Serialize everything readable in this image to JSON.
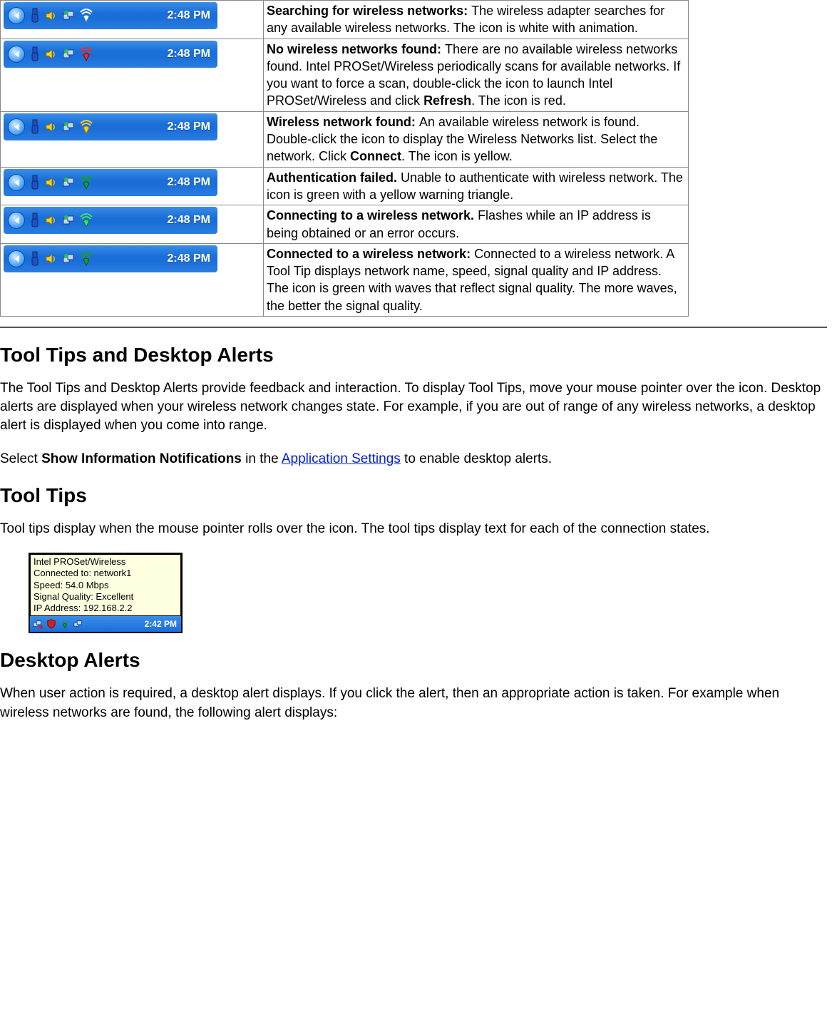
{
  "tray_time": "2:48 PM",
  "rows": [
    {
      "wifi_fill": "#ffffff",
      "wifi_stroke": "#2a7de0",
      "title": "Searching for wireless networks: ",
      "text_a": "The wireless adapter searches for any available wireless networks. The icon is white with animation.",
      "extra_bold": "",
      "text_b": ""
    },
    {
      "wifi_fill": "#e03030",
      "wifi_stroke": "#8a0000",
      "title": "No wireless networks found: ",
      "text_a": "There are no available wireless networks found. Intel PROSet/Wireless periodically scans for available networks. If you want to force a scan, double-click the icon to launch Intel PROSet/Wireless and click ",
      "extra_bold": "Refresh",
      "text_b": ". The icon is red."
    },
    {
      "wifi_fill": "#f5d020",
      "wifi_stroke": "#b08000",
      "title": "Wireless network found: ",
      "text_a": "An available wireless network is found. Double-click the icon to display the Wireless Networks list. Select the network. Click ",
      "extra_bold": "Connect",
      "text_b": ". The icon is yellow."
    },
    {
      "wifi_fill": "#1a9a3a",
      "wifi_stroke": "#0a5a1a",
      "title": "Authentication failed. ",
      "text_a": "Unable to authenticate with wireless network. The icon is green with a yellow warning triangle.",
      "extra_bold": "",
      "text_b": ""
    },
    {
      "wifi_fill": "#40e060",
      "wifi_stroke": "#0a7a2a",
      "title": "Connecting to a wireless network. ",
      "text_a": "Flashes while an IP address is being obtained or an error occurs.",
      "extra_bold": "",
      "text_b": ""
    },
    {
      "wifi_fill": "#1a9a3a",
      "wifi_stroke": "#0a5a1a",
      "title": "Connected to a wireless network: ",
      "text_a": "Connected to a wireless network. A Tool Tip displays network name, speed, signal quality and IP address. The icon is green with waves that reflect signal quality. The more waves, the better the signal quality.",
      "extra_bold": "",
      "text_b": ""
    }
  ],
  "h_tooltips_alerts": "Tool Tips and Desktop Alerts",
  "p_tooltips_alerts": "The Tool Tips and Desktop Alerts provide feedback and interaction. To display Tool Tips, move your mouse pointer over the icon. Desktop alerts are displayed when your wireless network changes state. For example, if you are out of range of any wireless networks, a desktop alert is displayed when you come into range.",
  "p_select_a": "Select ",
  "p_select_bold": "Show Information Notifications",
  "p_select_b": " in the ",
  "p_select_link": "Application Settings",
  "p_select_c": " to enable desktop alerts.",
  "h_tooltips": "Tool Tips",
  "p_tooltips": "Tool tips display when the mouse pointer rolls over the icon. The tool tips display text for each of the connection states.",
  "tooltip_lines": {
    "l1": "Intel PROSet/Wireless",
    "l2": "Connected to: network1",
    "l3": "Speed: 54.0 Mbps",
    "l4": "Signal Quality: Excellent",
    "l5": "IP Address: 192.168.2.2"
  },
  "tooltip_time": "2:42 PM",
  "h_desktop_alerts": "Desktop Alerts",
  "p_desktop_alerts": "When user action is required, a desktop alert displays. If you click the alert, then an appropriate action is taken. For example when wireless networks are found, the following alert displays:"
}
